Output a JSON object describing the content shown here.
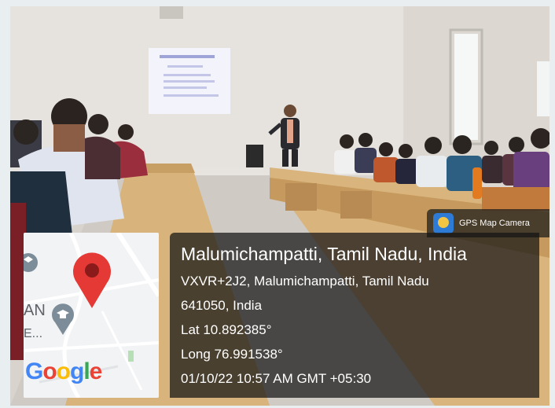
{
  "app_badge": {
    "label": "GPS Map Camera",
    "icon": "gps-map-camera-icon"
  },
  "location": {
    "title": "Malumichampatti, Tamil Nadu, India",
    "address_line1": "VXVR+2J2, Malumichampatti, Tamil Nadu",
    "address_line2": "641050, India",
    "latitude": "Lat 10.892385°",
    "longitude": "Long 76.991538°",
    "timestamp": "01/10/22 10:57 AM GMT +05:30"
  },
  "map": {
    "brand": "Google",
    "brand_colors": [
      "#4285F4",
      "#EA4335",
      "#FBBC05",
      "#4285F4",
      "#34A853",
      "#EA4335"
    ],
    "pin_color": "#E53935",
    "poi_icon": "education-poi-icon",
    "partial_text": "AN",
    "partial_text2": "E..."
  },
  "colors": {
    "overlay": "rgba(20,20,20,0.72)",
    "accent": "#2e7bd6"
  }
}
